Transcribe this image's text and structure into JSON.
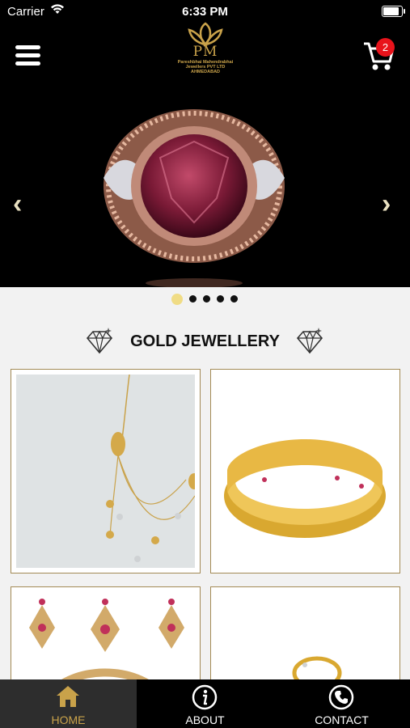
{
  "status_bar": {
    "carrier": "Carrier",
    "time": "6:33 PM"
  },
  "header": {
    "logo_letters": "PM",
    "logo_lines": [
      "Pareshbhai Mahendrabhai",
      "Jewellers PVT LTD",
      "AHMEDABAD"
    ],
    "cart_count": "2"
  },
  "carousel": {
    "prev": "‹",
    "next": "›",
    "dot_count": 5,
    "active_dot": 1
  },
  "section": {
    "title": "GOLD JEWELLERY"
  },
  "products": [
    {
      "name": "gold-chain-necklace"
    },
    {
      "name": "gold-bangle"
    },
    {
      "name": "gold-earrings-set"
    },
    {
      "name": "gold-ring"
    }
  ],
  "tabs": [
    {
      "label": "HOME",
      "icon": "home-icon",
      "active": true
    },
    {
      "label": "ABOUT",
      "icon": "info-icon",
      "active": false
    },
    {
      "label": "CONTACT",
      "icon": "phone-icon",
      "active": false
    }
  ],
  "colors": {
    "gold": "#c9a24a",
    "badge": "#e8131b",
    "active_dot": "#f0dc85",
    "tabbar": "#000000"
  }
}
